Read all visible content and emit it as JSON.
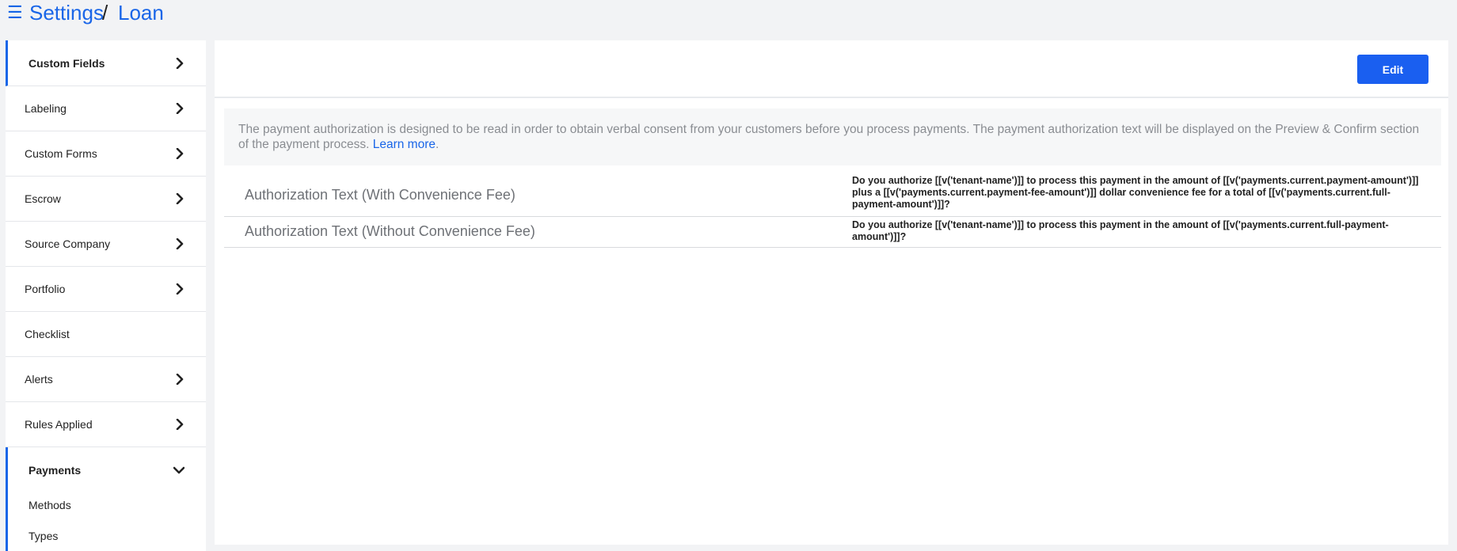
{
  "header": {
    "menu_icon": "hamburger-icon",
    "breadcrumb_root": "Settings",
    "breadcrumb_sep": "/",
    "breadcrumb_current": "Loan"
  },
  "sidebar": {
    "items": [
      {
        "label": "Custom Fields",
        "chevron": "chevron-right"
      },
      {
        "label": "Labeling",
        "chevron": "chevron-right"
      },
      {
        "label": "Custom Forms",
        "chevron": "chevron-right"
      },
      {
        "label": "Escrow",
        "chevron": "chevron-right"
      },
      {
        "label": "Source Company",
        "chevron": "chevron-right"
      },
      {
        "label": "Portfolio",
        "chevron": "chevron-right"
      },
      {
        "label": "Checklist",
        "chevron": ""
      },
      {
        "label": "Alerts",
        "chevron": "chevron-right"
      },
      {
        "label": "Rules Applied",
        "chevron": "chevron-right"
      },
      {
        "label": "Payments",
        "chevron": "chevron-down"
      }
    ],
    "sub_items": [
      {
        "label": "Methods"
      },
      {
        "label": "Types"
      }
    ]
  },
  "main": {
    "edit_label": "Edit",
    "info_text": "The payment authorization is designed to be read in order to obtain verbal consent from your customers before you process payments. The payment authorization text will be displayed on the Preview & Confirm section of the payment process.",
    "learn_more": "Learn more",
    "info_period": ".",
    "rows": [
      {
        "label": "Authorization Text (With Convenience Fee)",
        "value": "Do you authorize [[v('tenant-name')]] to process this payment in the amount of [[v('payments.current.payment-amount')]] plus a [[v('payments.current.payment-fee-amount')]] dollar convenience fee for a total of [[v('payments.current.full-payment-amount')]]?"
      },
      {
        "label": "Authorization Text (Without Convenience Fee)",
        "value": "Do you authorize [[v('tenant-name')]] to process this payment in the amount of [[v('payments.current.full-payment-amount')]]?"
      }
    ]
  },
  "colors": {
    "accent": "#1a66e8",
    "button": "#1a5ff0",
    "background": "#f2f3f5"
  }
}
